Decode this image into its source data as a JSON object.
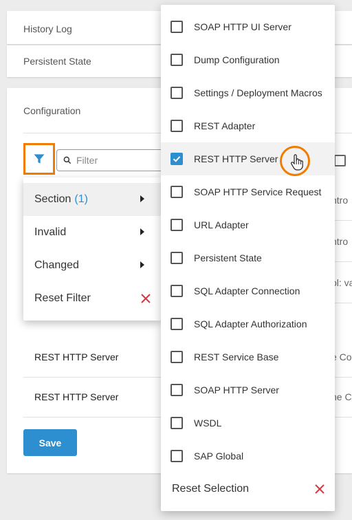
{
  "cards": {
    "history_label": "History Log",
    "persistent_label": "Persistent State"
  },
  "config": {
    "title": "Configuration",
    "filter_placeholder": "Filter",
    "save_label": "Save",
    "rows": [
      {
        "name": "",
        "value": "ntro"
      },
      {
        "name": "",
        "value": "ntro"
      },
      {
        "name": "",
        "value": "ol: va"
      },
      {
        "name": "REST HTTP Server",
        "value": "e Co"
      },
      {
        "name": "REST HTTP Server",
        "value": "he C"
      }
    ]
  },
  "filter_menu": {
    "items": [
      {
        "label": "Section",
        "count": "(1)"
      },
      {
        "label": "Invalid",
        "count": ""
      },
      {
        "label": "Changed",
        "count": ""
      }
    ],
    "reset_label": "Reset Filter"
  },
  "section_menu": {
    "items": [
      {
        "label": "SOAP HTTP UI Server",
        "checked": false
      },
      {
        "label": "Dump Configuration",
        "checked": false
      },
      {
        "label": "Settings / Deployment Macros",
        "checked": false
      },
      {
        "label": "REST Adapter",
        "checked": false
      },
      {
        "label": "REST HTTP Server",
        "checked": true
      },
      {
        "label": "SOAP HTTP Service Request",
        "checked": false
      },
      {
        "label": "URL Adapter",
        "checked": false
      },
      {
        "label": "Persistent State",
        "checked": false
      },
      {
        "label": "SQL Adapter Connection",
        "checked": false
      },
      {
        "label": "SQL Adapter Authorization",
        "checked": false
      },
      {
        "label": "REST Service Base",
        "checked": false
      },
      {
        "label": "SOAP HTTP Server",
        "checked": false
      },
      {
        "label": "WSDL",
        "checked": false
      },
      {
        "label": "SAP Global",
        "checked": false
      }
    ],
    "reset_label": "Reset Selection"
  },
  "icons": {
    "filter": "filter-icon",
    "search": "search-icon",
    "close": "close-icon",
    "check": "check-icon",
    "cursor": "hand-pointer-icon"
  },
  "colors": {
    "accent": "#2d8fd0",
    "highlight": "#f07d00",
    "reset_x": "#d9363e"
  }
}
